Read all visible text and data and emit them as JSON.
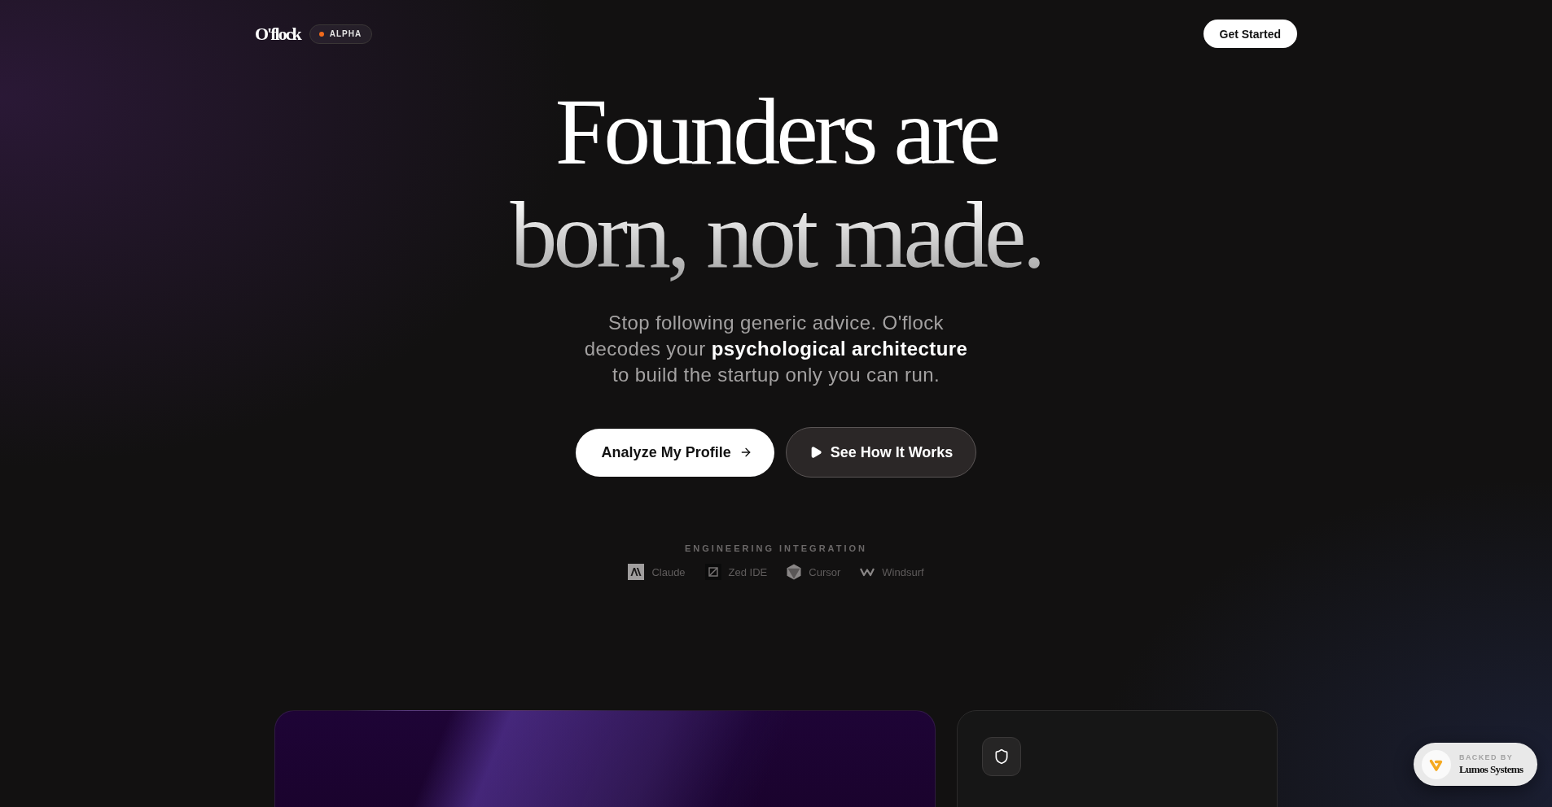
{
  "nav": {
    "logo": "O'flock",
    "badge": "ALPHA",
    "cta": "Get Started"
  },
  "hero": {
    "headline": "Founders are born, not made.",
    "subtitle": "Stop following generic advice. O'flock decodes your **psychological architecture** to build the startup only you can run.",
    "buttons": [
      {
        "kind": "primary",
        "label": "Analyze My Profile"
      },
      {
        "kind": "secondary",
        "label": "See How It Works"
      }
    ]
  },
  "integrations": {
    "title": "ENGINEERING INTEGRATION",
    "items": [
      {
        "kind": "mark",
        "label": "Claude"
      },
      {
        "kind": "tile",
        "label": "Zed IDE"
      },
      {
        "kind": "cube",
        "label": "Cursor"
      },
      {
        "kind": "zigzag",
        "label": "Windsurf"
      }
    ]
  },
  "cards": [
    {
      "kind": "gradient"
    },
    {
      "kind": "feature"
    }
  ],
  "backer": {
    "label": "BACKED BY",
    "name": "Lumos Systems"
  }
}
